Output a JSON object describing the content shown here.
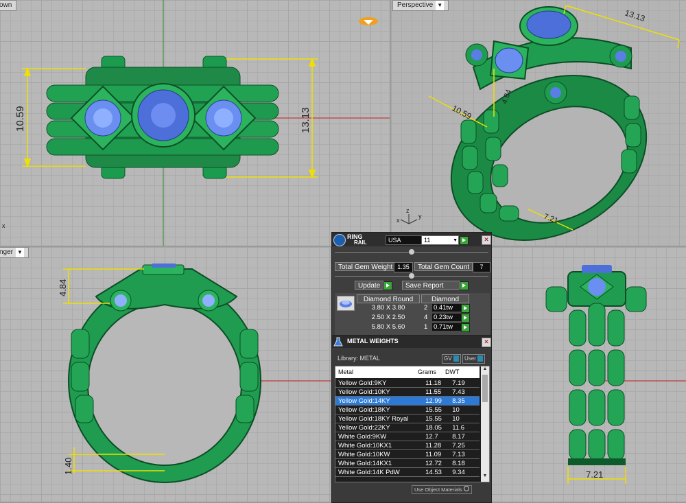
{
  "viewports": {
    "top": {
      "label": "own",
      "dim_left": "10.59",
      "dim_right": "13.13"
    },
    "perspective": {
      "label": "Perspective",
      "dim_top": "13.13",
      "dim_mid": "10.59",
      "dim_depth": "4.84",
      "dim_band": "7.21",
      "axis_z": "z",
      "axis_y": "y",
      "axis_x": "x"
    },
    "front": {
      "label": "nger",
      "dim_top": "4.84",
      "dim_bottom": "1.40"
    },
    "right": {
      "dim_bottom": "7.21"
    },
    "corner_mark": "x"
  },
  "ringrail": {
    "title_line1": "RING",
    "title_line2": "RAIL",
    "region": "USA",
    "size": "11",
    "total_gem_weight_label": "Total Gem Weight",
    "total_gem_weight_value": "1.35",
    "total_gem_count_label": "Total Gem Count",
    "total_gem_count_value": "7",
    "update_label": "Update",
    "save_report_label": "Save Report",
    "gem_header_shape": "Diamond Round",
    "gem_header_type": "Diamond",
    "gems": [
      {
        "size": "3.80 X 3.80",
        "count": "2",
        "weight": "0.41tw"
      },
      {
        "size": "2.50 X 2.50",
        "count": "4",
        "weight": "0.23tw"
      },
      {
        "size": "5.80 X 5.60",
        "count": "1",
        "weight": "0.71tw"
      }
    ]
  },
  "metal": {
    "title": "METAL WEIGHTS",
    "library_label": "Library: METAL",
    "gv_label": "GV",
    "user_label": "User",
    "col_metal": "Metal",
    "col_grams": "Grams",
    "col_dwt": "DWT",
    "selected_index": 2,
    "rows": [
      {
        "metal": "Yellow Gold:9KY",
        "grams": "11.18",
        "dwt": "7.19"
      },
      {
        "metal": "Yellow Gold:10KY",
        "grams": "11.55",
        "dwt": "7.43"
      },
      {
        "metal": "Yellow Gold:14KY",
        "grams": "12.99",
        "dwt": "8.35"
      },
      {
        "metal": "Yellow Gold:18KY",
        "grams": "15.55",
        "dwt": "10"
      },
      {
        "metal": "Yellow Gold:18KY Royal",
        "grams": "15.55",
        "dwt": "10"
      },
      {
        "metal": "Yellow Gold:22KY",
        "grams": "18.05",
        "dwt": "11.6"
      },
      {
        "metal": "White Gold:9KW",
        "grams": "12.7",
        "dwt": "8.17"
      },
      {
        "metal": "White Gold:10KX1",
        "grams": "11.28",
        "dwt": "7.25"
      },
      {
        "metal": "White Gold:10KW",
        "grams": "11.09",
        "dwt": "7.13"
      },
      {
        "metal": "White Gold:14KX1",
        "grams": "12.72",
        "dwt": "8.18"
      },
      {
        "metal": "White Gold:14K PdW",
        "grams": "14.53",
        "dwt": "9.34"
      }
    ],
    "use_object_materials": "Use Object Materials"
  },
  "colors": {
    "ring_green": "#1f8a48",
    "gem_blue": "#4d6fd9",
    "selection": "#2d7ad6",
    "dimension": "#f0e000"
  }
}
